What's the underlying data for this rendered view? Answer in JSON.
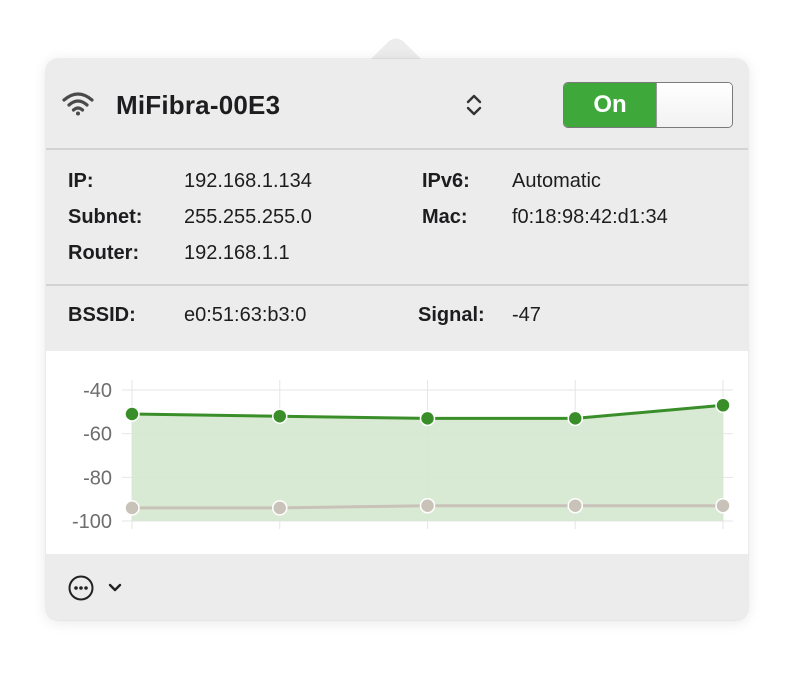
{
  "network": {
    "name": "MiFibra-00E3",
    "toggle_label": "On"
  },
  "details": {
    "ip_label": "IP:",
    "ip_value": "192.168.1.134",
    "subnet_label": "Subnet:",
    "subnet_value": "255.255.255.0",
    "router_label": "Router:",
    "router_value": "192.168.1.1",
    "ipv6_label": "IPv6:",
    "ipv6_value": "Automatic",
    "mac_label": "Mac:",
    "mac_value": "f0:18:98:42:d1:34",
    "bssid_label": "BSSID:",
    "bssid_value": "e0:51:63:b3:0",
    "signal_label": "Signal:",
    "signal_value": "-47"
  },
  "icons": {
    "wifi": "wifi-icon",
    "chooser": "chevron-up-down-icon",
    "more": "ellipsis-circle-icon",
    "dropdown": "chevron-down-icon"
  },
  "colors": {
    "signal_line": "#3a8e2a",
    "signal_fill": "#d5e8cf",
    "noise_line": "#c8c2b8",
    "toggle_on": "#3fa83b"
  },
  "chart_data": {
    "type": "area",
    "x": [
      1,
      2,
      3,
      4,
      5
    ],
    "ylim": [
      -100,
      -40
    ],
    "yticks": [
      -40,
      -60,
      -80,
      -100
    ],
    "ytick_labels": [
      "-40",
      "-60",
      "-80",
      "-100"
    ],
    "grid": true,
    "series": [
      {
        "key": "signal",
        "values": [
          -51,
          -52,
          -53,
          -53,
          -47
        ]
      },
      {
        "key": "noise",
        "values": [
          -94,
          -94,
          -93,
          -93,
          -93
        ]
      }
    ]
  }
}
